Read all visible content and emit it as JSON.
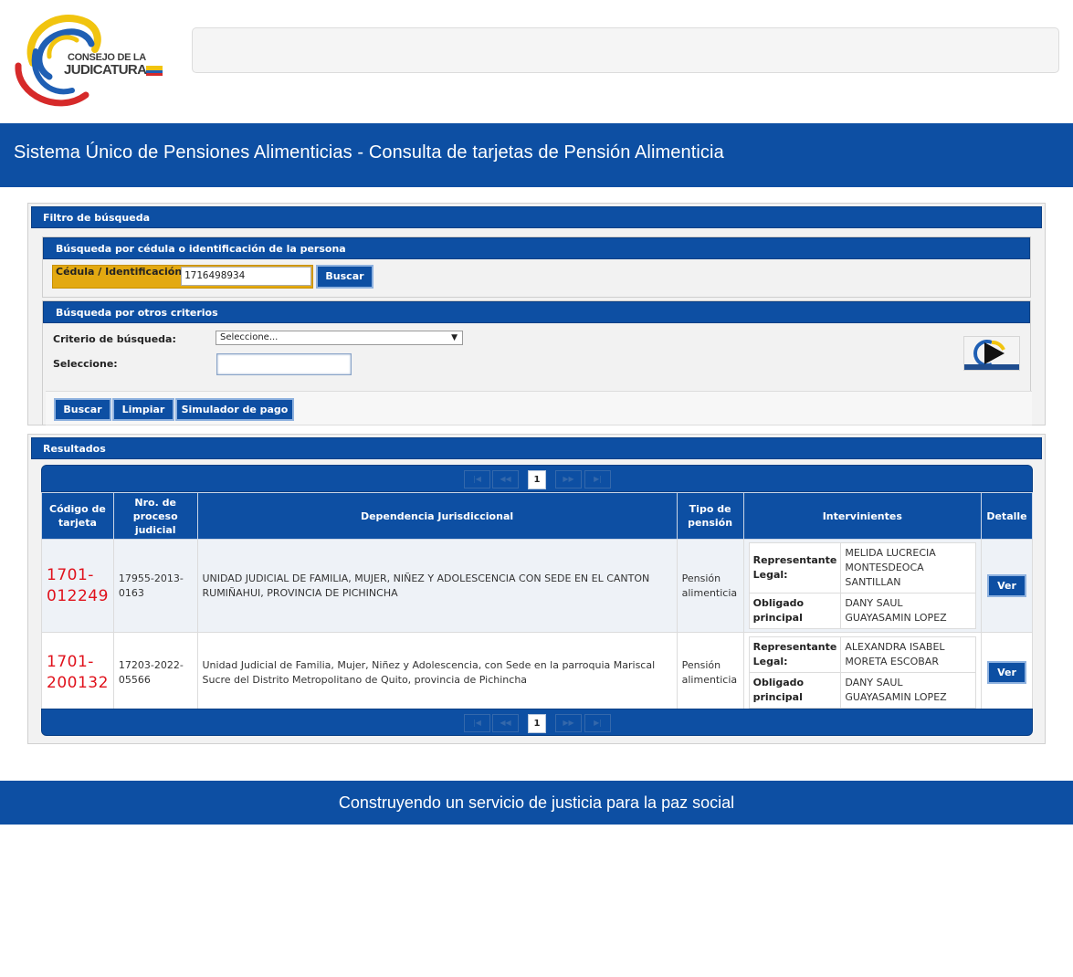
{
  "header": {
    "logo_line1": "CONSEJO DE LA",
    "logo_line2": "JUDICATURA",
    "title": "Sistema Único de Pensiones Alimenticias - Consulta de tarjetas de Pensión Alimenticia"
  },
  "colors": {
    "primary": "#0d4fa3",
    "highlight": "#e3a911",
    "code_red": "#e0121c"
  },
  "filter": {
    "title": "Filtro de búsqueda",
    "cedula_section": {
      "title": "Búsqueda por cédula o identificación de la persona",
      "label": "Cédula / Identificación:",
      "value": "1716498934",
      "search_button": "Buscar"
    },
    "other_section": {
      "title": "Búsqueda por otros criterios",
      "criterio_label": "Criterio de búsqueda:",
      "criterio_value": "Seleccione...",
      "seleccione_label": "Seleccione:",
      "seleccione_value": "",
      "video_icon": "play-video-icon"
    },
    "buttons": {
      "buscar": "Buscar",
      "limpiar": "Limpiar",
      "simulador": "Simulador de pago"
    }
  },
  "results": {
    "title": "Resultados",
    "pager": {
      "first": "|◀",
      "prev": "◀◀",
      "current": "1",
      "next": "▶▶",
      "last": "▶|"
    },
    "columns": [
      "Código de tarjeta",
      "Nro. de proceso judicial",
      "Dependencia Jurisdiccional",
      "Tipo de pensión",
      "Intervinientes",
      "Detalle"
    ],
    "rows": [
      {
        "codigo": "1701-012249",
        "proceso": "17955-2013-0163",
        "dependencia": "UNIDAD JUDICIAL DE FAMILIA, MUJER, NIÑEZ Y ADOLESCENCIA CON SEDE EN EL CANTON RUMIÑAHUI, PROVINCIA DE PICHINCHA",
        "tipo": "Pensión alimenticia",
        "rep_label": "Representante Legal:",
        "rep_name": "MELIDA LUCRECIA MONTESDEOCA SANTILLAN",
        "obl_label": "Obligado principal",
        "obl_name": "DANY SAUL GUAYASAMIN LOPEZ",
        "ver": "Ver"
      },
      {
        "codigo": "1701-200132",
        "proceso": "17203-2022-05566",
        "dependencia": "Unidad Judicial de Familia, Mujer, Niñez y Adolescencia, con Sede en la parroquia Mariscal Sucre del Distrito Metropolitano de Quito, provincia de Pichincha",
        "tipo": "Pensión alimenticia",
        "rep_label": "Representante Legal:",
        "rep_name": "ALEXANDRA ISABEL MORETA ESCOBAR",
        "obl_label": "Obligado principal",
        "obl_name": "DANY SAUL GUAYASAMIN LOPEZ",
        "ver": "Ver"
      }
    ]
  },
  "footer": {
    "text": "Construyendo un servicio de justicia para la paz social"
  }
}
